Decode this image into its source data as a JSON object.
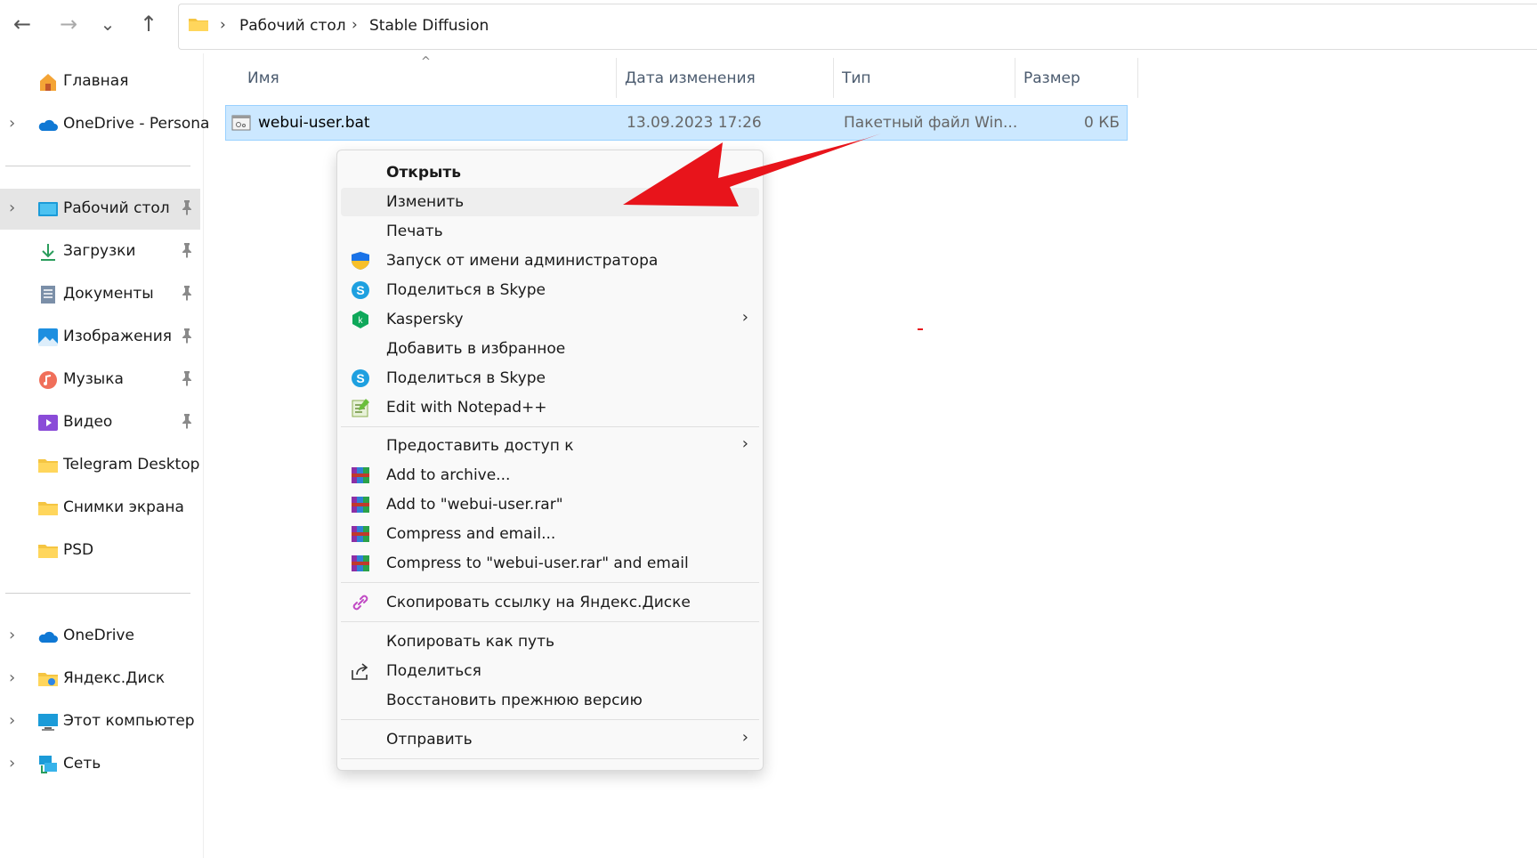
{
  "nav": {
    "back": "←",
    "forward": "→",
    "recent": "⌄",
    "up": "↑"
  },
  "breadcrumb": [
    "Рабочий стол",
    "Stable Diffusion"
  ],
  "breadcrumb_sep": "›",
  "sidebar": {
    "chevron": "›",
    "items": [
      {
        "label": "Главная",
        "icon": "home-icon"
      },
      {
        "label": "OneDrive - Persona",
        "icon": "cloud-icon"
      },
      {
        "label": "Рабочий стол",
        "icon": "desktop-icon"
      },
      {
        "label": "Загрузки",
        "icon": "download-icon"
      },
      {
        "label": "Документы",
        "icon": "document-icon"
      },
      {
        "label": "Изображения",
        "icon": "pictures-icon"
      },
      {
        "label": "Музыка",
        "icon": "music-icon"
      },
      {
        "label": "Видео",
        "icon": "video-icon"
      },
      {
        "label": "Telegram Desktop",
        "icon": "folder-icon"
      },
      {
        "label": "Снимки экрана",
        "icon": "folder-icon"
      },
      {
        "label": "PSD",
        "icon": "folder-icon"
      },
      {
        "label": "OneDrive",
        "icon": "cloud-icon"
      },
      {
        "label": "Яндекс.Диск",
        "icon": "yandex-disk-icon"
      },
      {
        "label": "Этот компьютер",
        "icon": "computer-icon"
      },
      {
        "label": "Сеть",
        "icon": "network-icon"
      }
    ]
  },
  "columns": {
    "name": "Имя",
    "date": "Дата изменения",
    "type": "Тип",
    "size": "Размер",
    "sort_indicator": "^"
  },
  "file": {
    "name": "webui-user.bat",
    "date": "13.09.2023 17:26",
    "type": "Пакетный файл Win...",
    "size": "0 КБ"
  },
  "menu": {
    "submenu_glyph": "›",
    "items": [
      {
        "label": "Открыть"
      },
      {
        "label": "Изменить"
      },
      {
        "label": "Печать"
      },
      {
        "label": "Запуск от имени администратора",
        "icon": "shield-icon"
      },
      {
        "label": "Поделиться в Skype",
        "icon": "skype-icon"
      },
      {
        "label": "Kaspersky",
        "icon": "kaspersky-icon"
      },
      {
        "label": "Добавить в избранное"
      },
      {
        "label": "Поделиться в Skype",
        "icon": "skype-icon"
      },
      {
        "label": "Edit with Notepad++",
        "icon": "notepadpp-icon"
      },
      {
        "label": "Предоставить доступ к"
      },
      {
        "label": "Add to archive...",
        "icon": "winrar-icon"
      },
      {
        "label": "Add to \"webui-user.rar\"",
        "icon": "winrar-icon"
      },
      {
        "label": "Compress and email...",
        "icon": "winrar-icon"
      },
      {
        "label": "Compress to \"webui-user.rar\" and email",
        "icon": "winrar-icon"
      },
      {
        "label": "Скопировать ссылку на Яндекс.Диске",
        "icon": "link-icon"
      },
      {
        "label": "Копировать как путь"
      },
      {
        "label": "Поделиться",
        "icon": "share-icon"
      },
      {
        "label": "Восстановить прежнюю версию"
      },
      {
        "label": "Отправить"
      }
    ]
  },
  "colors": {
    "selection": "#cce8ff",
    "arrow": "#e8141b",
    "accent": "#0067c0"
  }
}
